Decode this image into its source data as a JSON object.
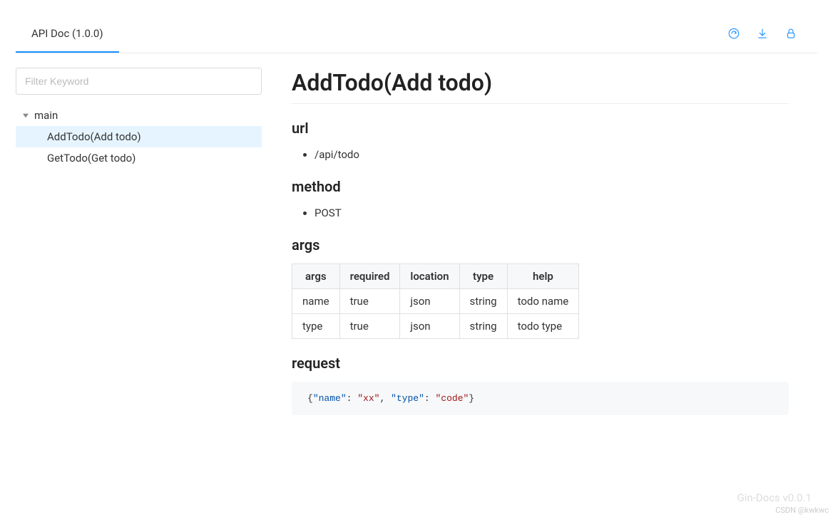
{
  "header": {
    "tab_label": "API Doc (1.0.0)"
  },
  "sidebar": {
    "filter_placeholder": "Filter Keyword",
    "group_label": "main",
    "items": [
      {
        "label": "AddTodo(Add todo)",
        "active": true
      },
      {
        "label": "GetTodo(Get todo)",
        "active": false
      }
    ]
  },
  "content": {
    "title": "AddTodo(Add todo)",
    "sections": {
      "url_heading": "url",
      "url_value": "/api/todo",
      "method_heading": "method",
      "method_value": "POST",
      "args_heading": "args",
      "request_heading": "request"
    },
    "args_table": {
      "headers": [
        "args",
        "required",
        "location",
        "type",
        "help"
      ],
      "rows": [
        [
          "name",
          "true",
          "json",
          "string",
          "todo name"
        ],
        [
          "type",
          "true",
          "json",
          "string",
          "todo type"
        ]
      ]
    },
    "request_code": {
      "pairs": [
        {
          "key": "\"name\"",
          "val": "\"xx\""
        },
        {
          "key": "\"type\"",
          "val": "\"code\""
        }
      ]
    }
  },
  "footer": {
    "version_watermark": "Gin-Docs v0.0.1",
    "csdn_watermark": "CSDN @kwkwc"
  }
}
